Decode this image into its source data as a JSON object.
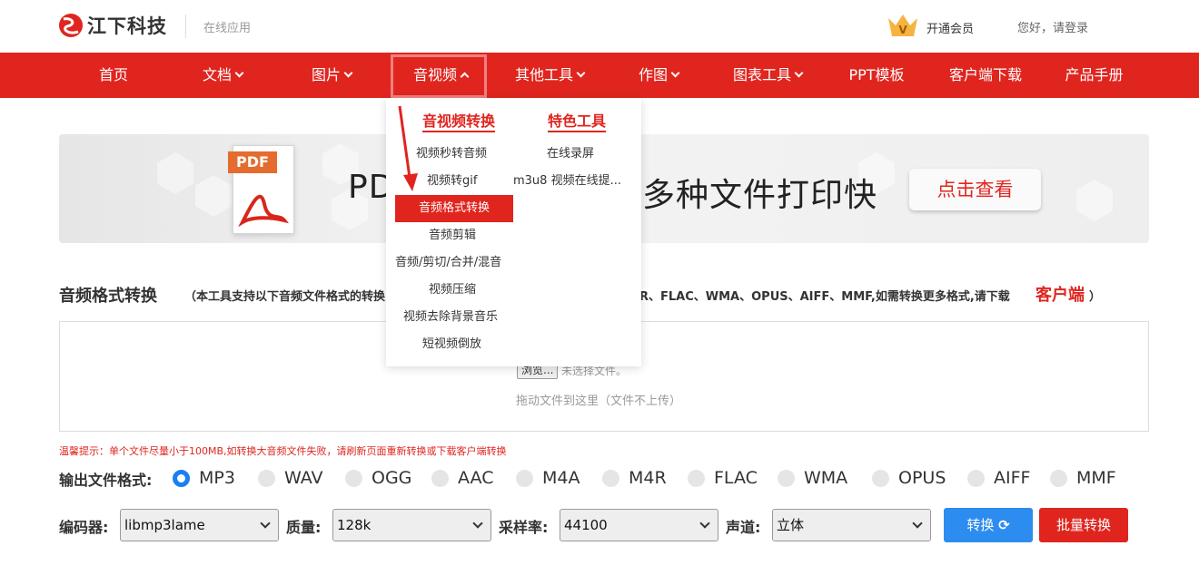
{
  "brand": {
    "logo_text": "江下科技",
    "subtitle": "在线应用"
  },
  "header": {
    "vip_label": "开通会员",
    "login_label": "您好，请登录"
  },
  "nav": {
    "items": [
      {
        "label": "首页"
      },
      {
        "label": "文档"
      },
      {
        "label": "图片"
      },
      {
        "label": "音视频"
      },
      {
        "label": "其他工具"
      },
      {
        "label": "作图"
      },
      {
        "label": "图表工具"
      },
      {
        "label": "PPT模板"
      },
      {
        "label": "客户端下载"
      },
      {
        "label": "产品手册"
      }
    ]
  },
  "dropdown": {
    "col1_title": "音视频转换",
    "col2_title": "特色工具",
    "col1_items": [
      "视频秒转音频",
      "视频转gif",
      "音频格式转换",
      "音频剪辑",
      "音频/剪切/合并/混音",
      "视频压缩",
      "视频去除背景音乐",
      "短视频倒放"
    ],
    "col2_items": [
      "在线录屏",
      "m3u8 视频在线提..."
    ]
  },
  "banner": {
    "pdf_tag": "PDF",
    "text_left": "PD",
    "text_right": "多种文件打印快",
    "button": "点击查看"
  },
  "section": {
    "title": "音频格式转换",
    "note_left": "（本工具支持以下音频文件格式的转换",
    "note_right": "R、FLAC、WMA、OPUS、AIFF、MMF,如需转换更多格式,请下载",
    "client_link": "客户端",
    "close_paren": "）"
  },
  "upload": {
    "browse": "浏览...",
    "no_file": "未选择文件。",
    "drag_hint": "拖动文件到这里（文件不上传）"
  },
  "tip": "温馨提示：单个文件尽量小于100MB,如转换大音频文件失败，请刷新页面重新转换或下载客户端转换",
  "format": {
    "label": "输出文件格式:",
    "options": [
      "MP3",
      "WAV",
      "OGG",
      "AAC",
      "M4A",
      "M4R",
      "FLAC",
      "WMA",
      "OPUS",
      "AIFF",
      "MMF"
    ],
    "selected": "MP3"
  },
  "options": {
    "encoder_label": "编码器:",
    "encoder_value": "libmp3lame",
    "quality_label": "质量:",
    "quality_value": "128k",
    "samplerate_label": "采样率:",
    "samplerate_value": "44100",
    "channel_label": "声道:",
    "channel_value": "立体"
  },
  "buttons": {
    "convert": "转换",
    "batch": "批量转换"
  },
  "colors": {
    "brand_red": "#e0251f",
    "accent_blue": "#2d8cf0"
  }
}
